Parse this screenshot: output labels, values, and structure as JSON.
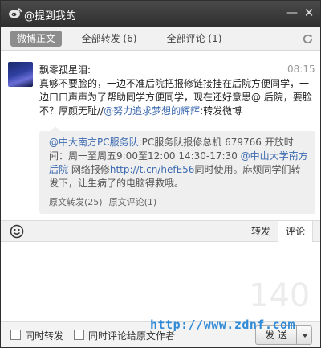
{
  "window": {
    "title": "@提到我的"
  },
  "tabs": [
    {
      "label": "微博正文",
      "active": true
    },
    {
      "label": "全部转发 (6)",
      "active": false
    },
    {
      "label": "全部评论 (1)",
      "active": false
    }
  ],
  "post": {
    "username": "飘零孤星泪:",
    "time": "08:15",
    "text_line1": "真够不要脸的，一边不准后院把报修链接挂在后院方便同学，一",
    "text_line2": "边口口声声为了帮助同学方便同学，现在还好意思@ 后院，要脸",
    "text_line3_a": "不？厚颜无耻//",
    "text_line3_mention": "@努力追求梦想的辉辉",
    "text_line3_b": ":转发微博"
  },
  "repost": {
    "mention": "@中大南方PC服务队",
    "text1": ":PC服务队报修总机  679766 开放时",
    "text2": "间：周一至周五9:00至12:00 14:30-17:30 ",
    "mention2": "@中山大学南方",
    "mention2b": "后院",
    "text3": " 网络报修",
    "link": "http://t.cn/hefE56",
    "text4": "同时使用。麻烦同学们转",
    "text5": "发下，让生病了的电脑得救哦。",
    "repost_count": "原文转发(25)",
    "comment_count": "原文评论(1)"
  },
  "actions": {
    "repost_label": "转发",
    "comment_label": "评论"
  },
  "editor": {
    "counter": "140"
  },
  "footer": {
    "check1_label": "同时转发",
    "check2_label": "同时评论给原文作者",
    "send_label": "发 送"
  },
  "watermark": "http://www.zdnf.com",
  "colors": {
    "titlebar": "#3a3a3a",
    "active_tab": "#8c8c8c",
    "link": "#3d6ab0",
    "watermark": "#2f8ad8"
  }
}
